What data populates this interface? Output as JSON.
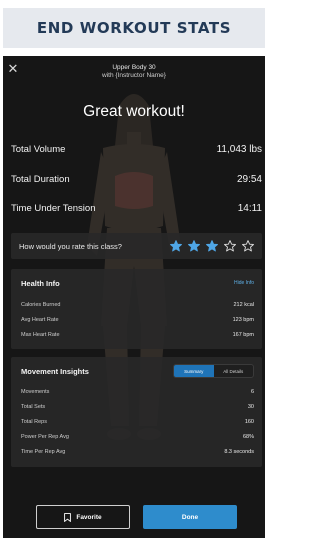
{
  "banner": {
    "title": "END WORKOUT STATS"
  },
  "header": {
    "close_icon": "close-icon",
    "class_title": "Upper Body 30",
    "instructor": "with {Instructor Name}"
  },
  "headline": "Great workout!",
  "stats": [
    {
      "label": "Total Volume",
      "value": "11,043 lbs"
    },
    {
      "label": "Total Duration",
      "value": "29:54"
    },
    {
      "label": "Time Under Tension",
      "value": "14:11"
    }
  ],
  "rating": {
    "question": "How would you rate this class?",
    "filled_stars": 3,
    "total_stars": 5,
    "star_color": "#4fa6e6"
  },
  "health": {
    "title": "Health Info",
    "toggle_label": "Hide Info",
    "rows": [
      {
        "label": "Calories Burned",
        "value": "212 kcal"
      },
      {
        "label": "Avg Heart Rate",
        "value": "123 bpm"
      },
      {
        "label": "Max Heart Rate",
        "value": "167 bpm"
      }
    ]
  },
  "movement": {
    "title": "Movement Insights",
    "tabs": [
      {
        "label": "Summary",
        "active": true
      },
      {
        "label": "All Details",
        "active": false
      }
    ],
    "rows": [
      {
        "label": "Movements",
        "value": "6"
      },
      {
        "label": "Total Sets",
        "value": "30"
      },
      {
        "label": "Total Reps",
        "value": "160"
      },
      {
        "label": "Power Per Rep Avg",
        "value": "68%"
      },
      {
        "label": "Time Per Rep Avg",
        "value": "8.3 seconds"
      }
    ]
  },
  "actions": {
    "favorite_label": "Favorite",
    "favorite_icon": "bookmark-icon",
    "done_label": "Done"
  },
  "colors": {
    "accent": "#2e8ccc",
    "banner_bg": "#e6e9ee",
    "banner_text": "#233a57",
    "screen_bg": "#161616"
  }
}
